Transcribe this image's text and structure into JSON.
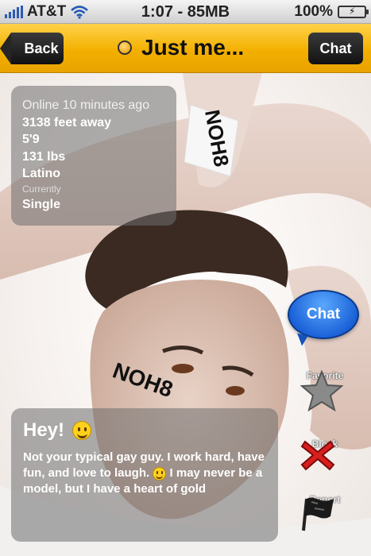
{
  "status_bar": {
    "carrier": "AT&T",
    "time_memory": "1:07 - 85MB",
    "battery": "100%"
  },
  "nav": {
    "back_label": "Back",
    "title": "Just me...",
    "chat_label": "Chat"
  },
  "profile": {
    "online": "Online 10 minutes ago",
    "distance": "3138 feet away",
    "height": "5'9",
    "weight": "131 lbs",
    "ethnicity": "Latino",
    "currently_label": "Currently",
    "relationship": "Single"
  },
  "bio": {
    "headline": "Hey!",
    "text_part1": "Not your typical gay guy. I work hard, have fun, and love to laugh.",
    "text_part2": "I may never be a model, but I have a heart of gold"
  },
  "actions": {
    "chat_bubble_label": "Chat",
    "favorite_label": "Favorite",
    "block_label": "Block",
    "report_label": "Report"
  },
  "photo_text": {
    "wristband": "NOH8",
    "face_logo": "NOH8"
  },
  "colors": {
    "navbar": "#f3b000",
    "chat_bubble": "#1b62d8",
    "block": "#d81e1e"
  }
}
